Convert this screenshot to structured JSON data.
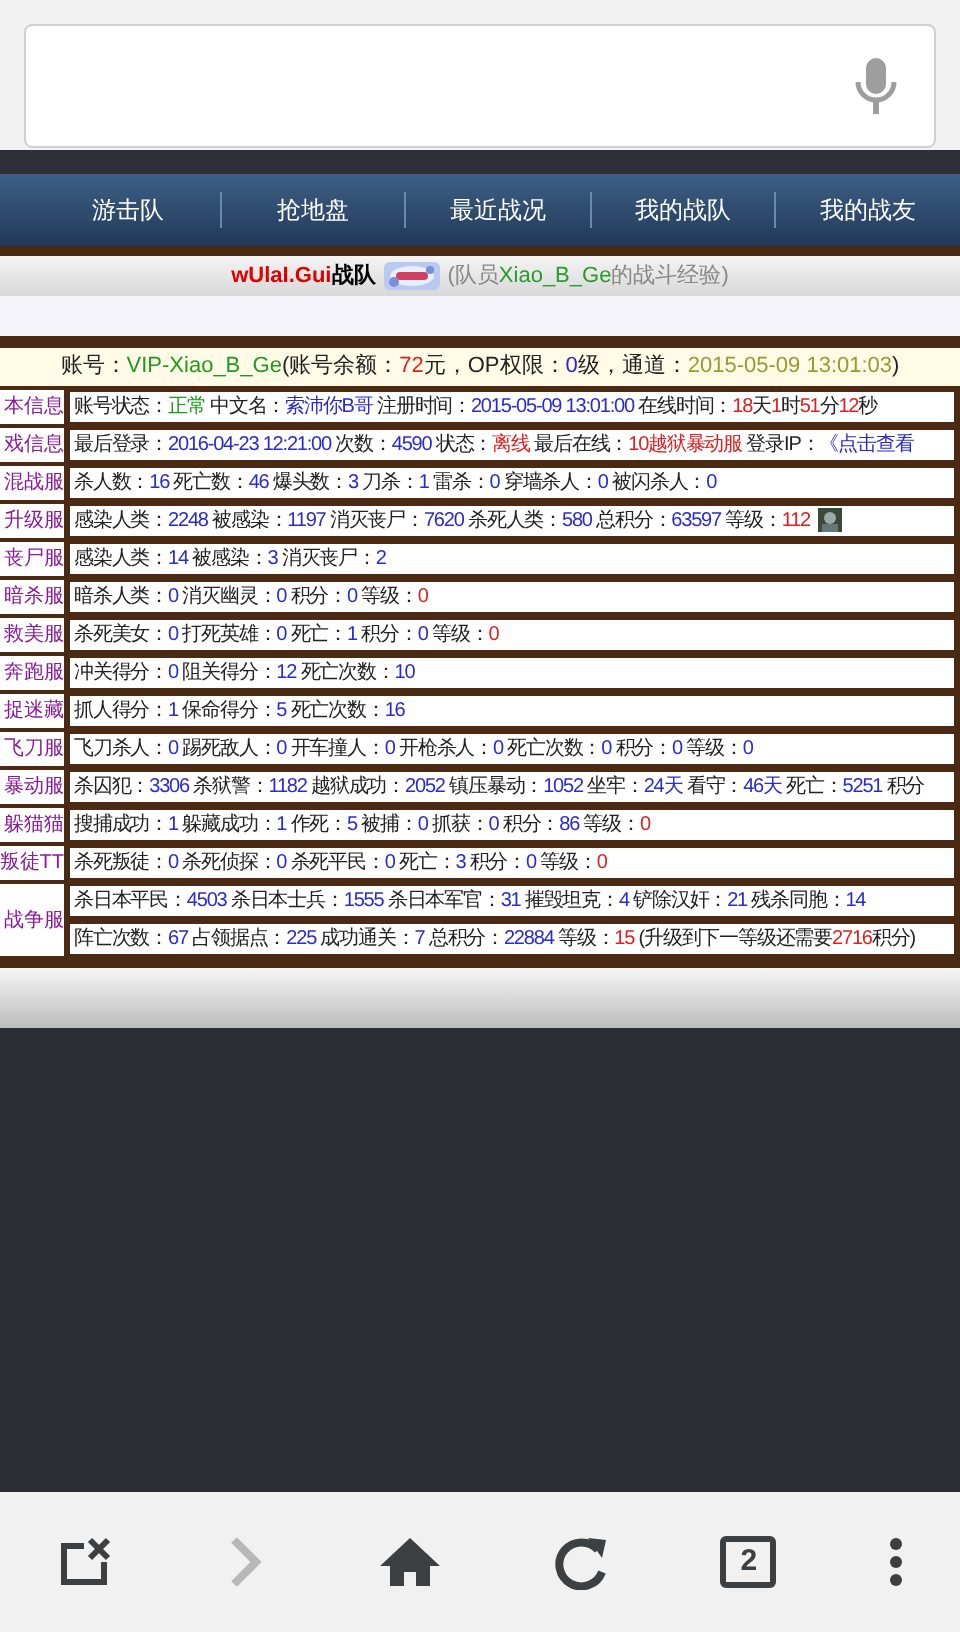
{
  "address_bar": {
    "voice_search": true
  },
  "nav": {
    "items": [
      {
        "label": "游击队",
        "selected": false
      },
      {
        "label": "抢地盘",
        "selected": false
      },
      {
        "label": "最近战况",
        "selected": false
      },
      {
        "label": "我的战队",
        "selected": false
      },
      {
        "label": "我的战友",
        "selected": false
      }
    ]
  },
  "team_line": {
    "team": "wUlaI.Gui",
    "suffix": "战队",
    "logo": {
      "kind": "picture"
    },
    "member_prefix": "(队员",
    "member": "Xiao_B_Ge",
    "member_suffix": "的战斗经验)"
  },
  "account_line": [
    {
      "label": "账号：",
      "value": "VIP-Xiao_B_Ge",
      "kind": "ok"
    },
    {
      "label": "(账号余额：",
      "value": "72",
      "kind": "alert"
    },
    {
      "label": "元，OP权限：",
      "value": "0",
      "kind": "value"
    },
    {
      "label": "级，通道：",
      "value": "2015-05-09 13:01:03",
      "kind": "date"
    },
    {
      "label": ")"
    }
  ],
  "rows": [
    {
      "server": "本信息",
      "lines": [
        [
          {
            "label": "账号状态：",
            "value": "正常",
            "kind": "ok"
          },
          {
            "label": " 中文名：",
            "value": "索沛你B哥",
            "kind": "value"
          },
          {
            "label": " 注册时间：",
            "value": "2015-05-09 13:01:00",
            "kind": "value"
          },
          {
            "label": " 在线时间：",
            "value": "18",
            "kind": "alert"
          },
          {
            "label": "天",
            "value": "1",
            "kind": "alert"
          },
          {
            "label": "时",
            "value": "51",
            "kind": "alert"
          },
          {
            "label": "分",
            "value": "12",
            "kind": "alert"
          },
          {
            "label": "秒"
          }
        ]
      ]
    },
    {
      "server": "戏信息",
      "lines": [
        [
          {
            "label": "最后登录：",
            "value": "2016-04-23 12:21:00",
            "kind": "value"
          },
          {
            "label": " 次数：",
            "value": "4590",
            "kind": "value"
          },
          {
            "label": " 状态：",
            "value": "离线",
            "kind": "alert"
          },
          {
            "label": " 最后在线：",
            "value": "10越狱暴动服",
            "kind": "alert"
          },
          {
            "label": " 登录IP：",
            "value": "《点击查看",
            "kind": "value"
          }
        ]
      ]
    },
    {
      "server": "混战服",
      "lines": [
        [
          {
            "label": "杀人数：",
            "value": "16",
            "kind": "value"
          },
          {
            "label": " 死亡数：",
            "value": "46",
            "kind": "value"
          },
          {
            "label": " 爆头数：",
            "value": "3",
            "kind": "value"
          },
          {
            "label": " 刀杀：",
            "value": "1",
            "kind": "value"
          },
          {
            "label": " 雷杀：",
            "value": "0",
            "kind": "value"
          },
          {
            "label": " 穿墙杀人：",
            "value": "0",
            "kind": "value"
          },
          {
            "label": " 被闪杀人：",
            "value": "0",
            "kind": "value"
          }
        ]
      ]
    },
    {
      "server": "升级服",
      "lines": [
        [
          {
            "label": "感染人类：",
            "value": "2248",
            "kind": "value"
          },
          {
            "label": " 被感染：",
            "value": "1197",
            "kind": "value"
          },
          {
            "label": " 消灭丧尸：",
            "value": "7620",
            "kind": "value"
          },
          {
            "label": " 杀死人类：",
            "value": "580",
            "kind": "value"
          },
          {
            "label": " 总积分：",
            "value": "63597",
            "kind": "value"
          },
          {
            "label": " 等级：",
            "value": "112",
            "kind": "alert"
          },
          {
            "kind": "picture"
          }
        ]
      ]
    },
    {
      "server": "丧尸服",
      "lines": [
        [
          {
            "label": "感染人类：",
            "value": "14",
            "kind": "value"
          },
          {
            "label": " 被感染：",
            "value": "3",
            "kind": "value"
          },
          {
            "label": " 消灭丧尸：",
            "value": "2",
            "kind": "value"
          }
        ]
      ]
    },
    {
      "server": "暗杀服",
      "lines": [
        [
          {
            "label": "暗杀人类：",
            "value": "0",
            "kind": "value"
          },
          {
            "label": " 消灭幽灵：",
            "value": "0",
            "kind": "value"
          },
          {
            "label": " 积分：",
            "value": "0",
            "kind": "value"
          },
          {
            "label": " 等级：",
            "value": "0",
            "kind": "alert"
          }
        ]
      ]
    },
    {
      "server": "救美服",
      "lines": [
        [
          {
            "label": "杀死美女：",
            "value": "0",
            "kind": "value"
          },
          {
            "label": " 打死英雄：",
            "value": "0",
            "kind": "value"
          },
          {
            "label": " 死亡：",
            "value": "1",
            "kind": "value"
          },
          {
            "label": " 积分：",
            "value": "0",
            "kind": "value"
          },
          {
            "label": " 等级：",
            "value": "0",
            "kind": "alert"
          }
        ]
      ]
    },
    {
      "server": "奔跑服",
      "lines": [
        [
          {
            "label": "冲关得分：",
            "value": "0",
            "kind": "value"
          },
          {
            "label": " 阻关得分：",
            "value": "12",
            "kind": "value"
          },
          {
            "label": " 死亡次数：",
            "value": "10",
            "kind": "value"
          }
        ]
      ]
    },
    {
      "server": "捉迷藏",
      "lines": [
        [
          {
            "label": "抓人得分：",
            "value": "1",
            "kind": "value"
          },
          {
            "label": " 保命得分：",
            "value": "5",
            "kind": "value"
          },
          {
            "label": " 死亡次数：",
            "value": "16",
            "kind": "value"
          }
        ]
      ]
    },
    {
      "server": "飞刀服",
      "lines": [
        [
          {
            "label": "飞刀杀人：",
            "value": "0",
            "kind": "value"
          },
          {
            "label": " 踢死敌人：",
            "value": "0",
            "kind": "value"
          },
          {
            "label": " 开车撞人：",
            "value": "0",
            "kind": "value"
          },
          {
            "label": " 开枪杀人：",
            "value": "0",
            "kind": "value"
          },
          {
            "label": " 死亡次数：",
            "value": "0",
            "kind": "value"
          },
          {
            "label": " 积分：",
            "value": "0",
            "kind": "value"
          },
          {
            "label": " 等级：",
            "value": "0",
            "kind": "value"
          }
        ]
      ]
    },
    {
      "server": "暴动服",
      "lines": [
        [
          {
            "label": "杀囚犯：",
            "value": "3306",
            "kind": "value"
          },
          {
            "label": " 杀狱警：",
            "value": "1182",
            "kind": "value"
          },
          {
            "label": " 越狱成功：",
            "value": "2052",
            "kind": "value"
          },
          {
            "label": " 镇压暴动：",
            "value": "1052",
            "kind": "value"
          },
          {
            "label": " 坐牢：",
            "value": "24天",
            "kind": "value"
          },
          {
            "label": " 看守：",
            "value": "46天",
            "kind": "value"
          },
          {
            "label": " 死亡：",
            "value": "5251",
            "kind": "value"
          },
          {
            "label": " 积分"
          }
        ]
      ]
    },
    {
      "server": "躲猫猫",
      "lines": [
        [
          {
            "label": "搜捕成功：",
            "value": "1",
            "kind": "value"
          },
          {
            "label": " 躲藏成功：",
            "value": "1",
            "kind": "value"
          },
          {
            "label": " 作死：",
            "value": "5",
            "kind": "value"
          },
          {
            "label": " 被捕：",
            "value": "0",
            "kind": "value"
          },
          {
            "label": " 抓获：",
            "value": "0",
            "kind": "value"
          },
          {
            "label": " 积分：",
            "value": "86",
            "kind": "value"
          },
          {
            "label": " 等级：",
            "value": "0",
            "kind": "alert"
          }
        ]
      ]
    },
    {
      "server": "叛徒TT",
      "lines": [
        [
          {
            "label": "杀死叛徒：",
            "value": "0",
            "kind": "value"
          },
          {
            "label": " 杀死侦探：",
            "value": "0",
            "kind": "value"
          },
          {
            "label": " 杀死平民：",
            "value": "0",
            "kind": "value"
          },
          {
            "label": " 死亡：",
            "value": "3",
            "kind": "value"
          },
          {
            "label": " 积分：",
            "value": "0",
            "kind": "value"
          },
          {
            "label": " 等级：",
            "value": "0",
            "kind": "alert"
          }
        ]
      ]
    },
    {
      "server": "战争服",
      "lines": [
        [
          {
            "label": "杀日本平民：",
            "value": "4503",
            "kind": "value"
          },
          {
            "label": " 杀日本士兵：",
            "value": "1555",
            "kind": "value"
          },
          {
            "label": " 杀日本军官：",
            "value": "31",
            "kind": "value"
          },
          {
            "label": " 摧毁坦克：",
            "value": "4",
            "kind": "value"
          },
          {
            "label": " 铲除汉奸：",
            "value": "21",
            "kind": "value"
          },
          {
            "label": " 残杀同胞：",
            "value": "14",
            "kind": "value"
          }
        ],
        [
          {
            "label": "阵亡次数：",
            "value": "67",
            "kind": "value"
          },
          {
            "label": " 占领据点：",
            "value": "225",
            "kind": "value"
          },
          {
            "label": " 成功通关：",
            "value": "7",
            "kind": "value"
          },
          {
            "label": " 总积分：",
            "value": "22884",
            "kind": "value"
          },
          {
            "label": " 等级：",
            "value": "15",
            "kind": "alert"
          },
          {
            "label": " (升级到下一等级还需要",
            "value": "2716",
            "kind": "alert"
          },
          {
            "label": "积分)"
          }
        ]
      ]
    }
  ],
  "toolbar": [
    {
      "kind": "close_tab",
      "disabled": false
    },
    {
      "kind": "forward",
      "disabled": true
    },
    {
      "kind": "home",
      "disabled": false
    },
    {
      "kind": "reload",
      "disabled": false
    },
    {
      "kind": "tabs",
      "count": "2",
      "disabled": false
    },
    {
      "kind": "menu",
      "disabled": false
    }
  ]
}
